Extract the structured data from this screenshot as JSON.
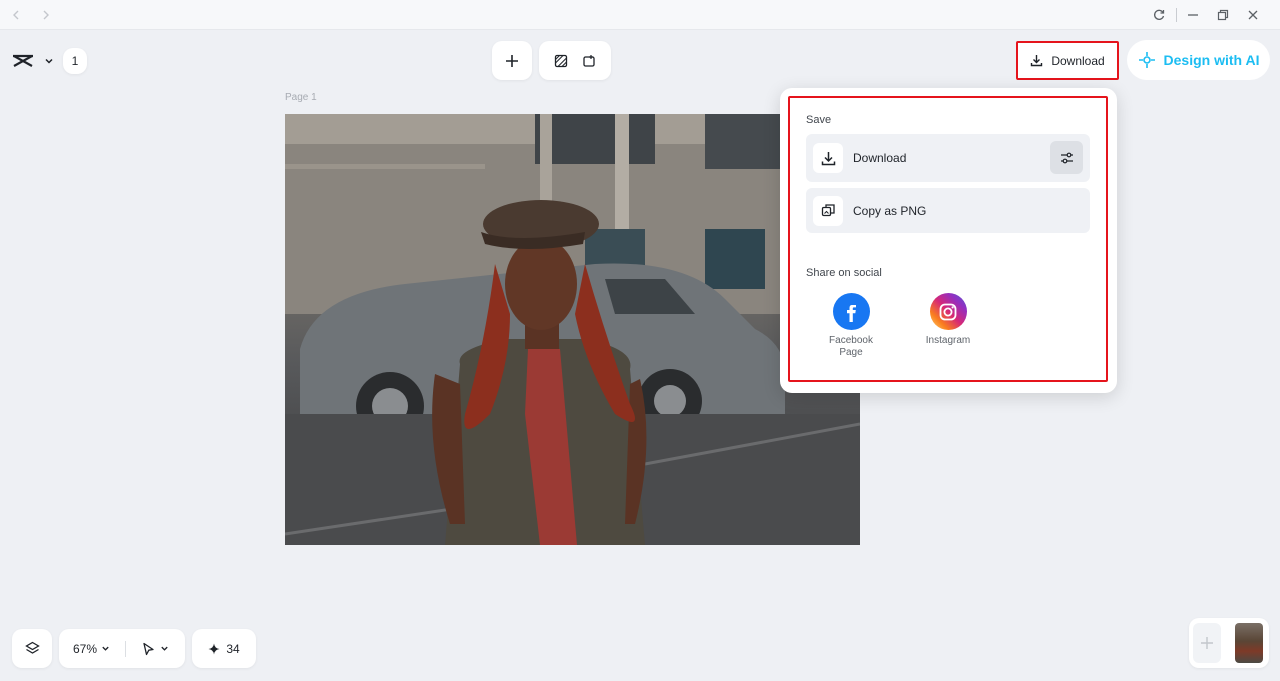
{
  "header": {
    "page_count": "1",
    "download_label": "Download",
    "ai_label": "Design with AI"
  },
  "canvas": {
    "page_label": "Page 1"
  },
  "popup": {
    "save_title": "Save",
    "download_label": "Download",
    "copy_label": "Copy as PNG",
    "share_title": "Share on social",
    "social": [
      {
        "label_line1": "Facebook",
        "label_line2": "Page",
        "icon": "facebook-icon"
      },
      {
        "label_line1": "Instagram",
        "label_line2": "",
        "icon": "instagram-icon"
      }
    ]
  },
  "bottom": {
    "zoom": "67%",
    "credits": "34"
  },
  "colors": {
    "highlight": "#e5141c",
    "ai_accent": "#1cbdf2",
    "facebook": "#1877f2"
  }
}
